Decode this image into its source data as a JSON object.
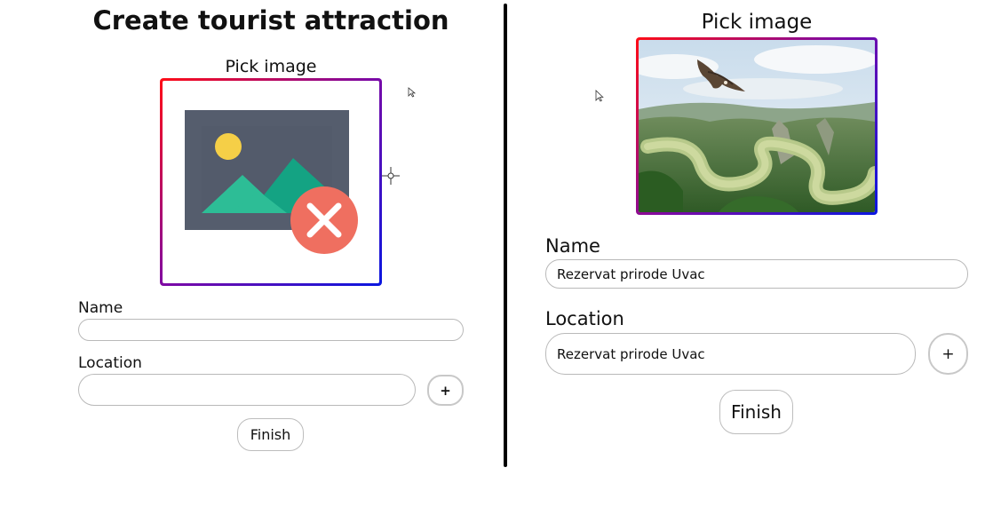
{
  "left": {
    "title": "Create tourist attraction",
    "pick_image_label": "Pick image",
    "image_placeholder_icon": "broken-image-icon",
    "name_label": "Name",
    "name_value": "",
    "location_label": "Location",
    "location_value": "",
    "add_location_label": "+",
    "finish_label": "Finish"
  },
  "right": {
    "pick_image_label": "Pick image",
    "image_icon": "landscape-photo-uvac",
    "name_label": "Name",
    "name_value": "Rezervat prirode Uvac",
    "location_label": "Location",
    "location_value": "Rezervat prirode Uvac",
    "add_location_label": "+",
    "finish_label": "Finish"
  },
  "colors": {
    "frame_gradient_start": "#ff0d16",
    "frame_gradient_end": "#0a17e0",
    "divider": "#000000",
    "input_border": "#b9b9b9"
  }
}
